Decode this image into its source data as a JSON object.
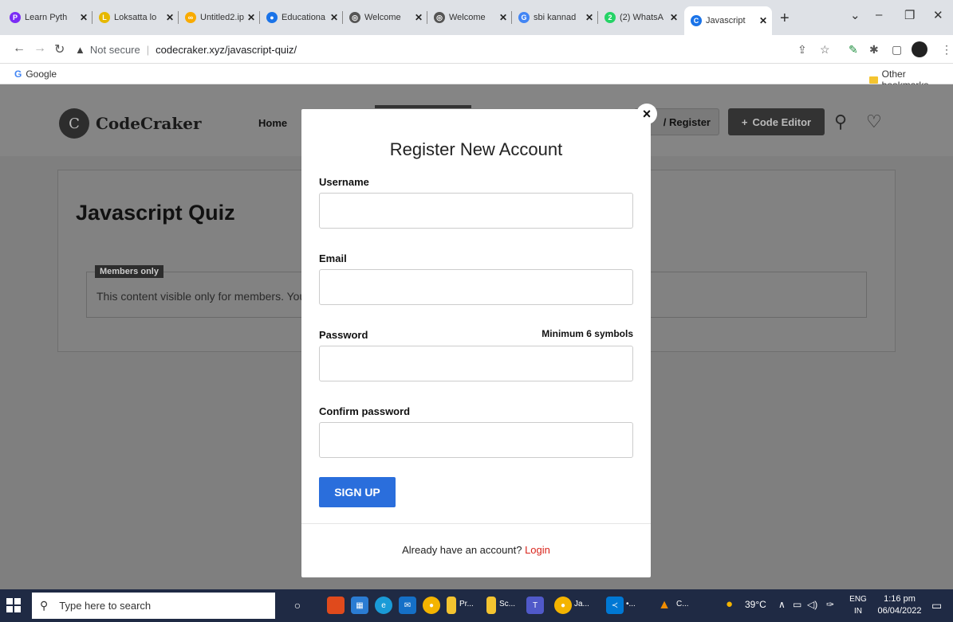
{
  "tabs": [
    {
      "title": "Learn Pyth",
      "icon": "pycharm-icon",
      "color": "#7b2cf5"
    },
    {
      "title": "Loksatta lo",
      "icon": "loksatta-icon",
      "color": "#e6b800"
    },
    {
      "title": "Untitled2.ip",
      "icon": "colab-icon",
      "color": "#f9ab00"
    },
    {
      "title": "Educationa",
      "icon": "education-icon",
      "color": "#1a73e8"
    },
    {
      "title": "Welcome",
      "icon": "globe-icon",
      "color": "#555555"
    },
    {
      "title": "Welcome",
      "icon": "globe-icon",
      "color": "#555555"
    },
    {
      "title": "sbi kannad",
      "icon": "google-icon",
      "color": "#4285f4"
    },
    {
      "title": "(2) WhatsA",
      "icon": "whatsapp-icon",
      "color": "#25d366"
    },
    {
      "title": "Javascript",
      "icon": "codecraker-icon",
      "color": "#1a73e8",
      "active": true
    }
  ],
  "address": {
    "security": "Not secure",
    "url": "codecraker.xyz/javascript-quiz/"
  },
  "bookmarks": {
    "google": "Google",
    "other": "Other bookmarks"
  },
  "site": {
    "logo_letter": "C",
    "logo_text": "CodeCraker",
    "nav_home": "Home",
    "login_register": "/ Register",
    "code_editor": "Code Editor",
    "page_title": "Javascript Quiz",
    "members_badge": "Members only",
    "members_text": "This content visible only for members. You"
  },
  "modal": {
    "close": "×",
    "title": "Register New Account",
    "username_label": "Username",
    "email_label": "Email",
    "password_label": "Password",
    "password_hint": "Minimum 6 symbols",
    "confirm_label": "Confirm password",
    "signup": "SIGN UP",
    "footer_text": "Already have an account?",
    "footer_link": "Login"
  },
  "taskbar": {
    "search_placeholder": "Type here to search",
    "apps": [
      {
        "label": "Pr..."
      },
      {
        "label": "Sc..."
      },
      {
        "label": "Ja..."
      },
      {
        "label": "•..."
      },
      {
        "label": "C..."
      }
    ],
    "weather": "39°C",
    "lang_top": "ENG",
    "lang_bottom": "IN",
    "time": "1:16 pm",
    "date": "06/04/2022"
  }
}
